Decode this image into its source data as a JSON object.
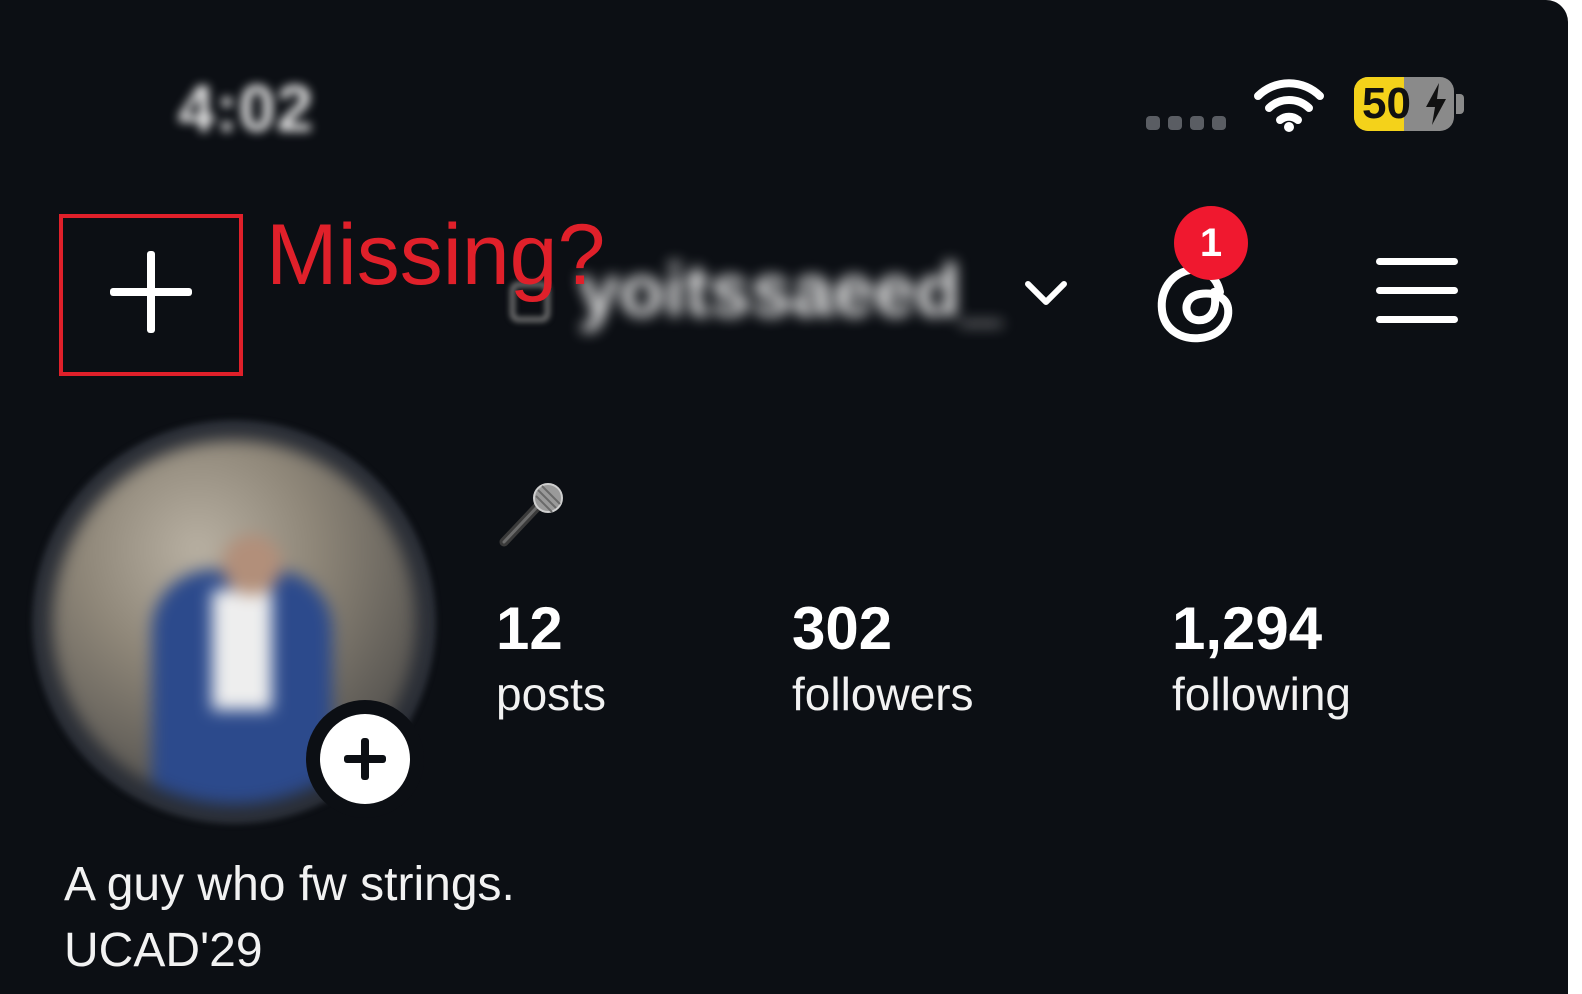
{
  "status_bar": {
    "time": "4:02",
    "battery_percent": "50",
    "battery_level": 0.5,
    "battery_color": "#f4d21a",
    "icons": [
      "signal-dots-icon",
      "wifi-icon",
      "battery-charging-icon"
    ]
  },
  "header": {
    "new_post_icon": "plus-icon",
    "username": "yoitssaeed_",
    "username_dropdown_icon": "chevron-down-icon",
    "threads_icon": "threads-icon",
    "threads_badge": "1",
    "menu_icon": "hamburger-menu-icon"
  },
  "annotation": {
    "text": "Missing?",
    "color": "#e0202a"
  },
  "profile": {
    "name_emoji_icon": "microphone-icon",
    "add_story_icon": "plus-circle-icon",
    "stats": [
      {
        "count": "12",
        "label": "posts"
      },
      {
        "count": "302",
        "label": "followers"
      },
      {
        "count": "1,294",
        "label": "following"
      }
    ],
    "bio_lines": [
      "A guy who fw strings.",
      "UCAD'29"
    ]
  },
  "colors": {
    "background": "#0c0f14",
    "badge": "#f0182f",
    "text": "#ffffff"
  }
}
